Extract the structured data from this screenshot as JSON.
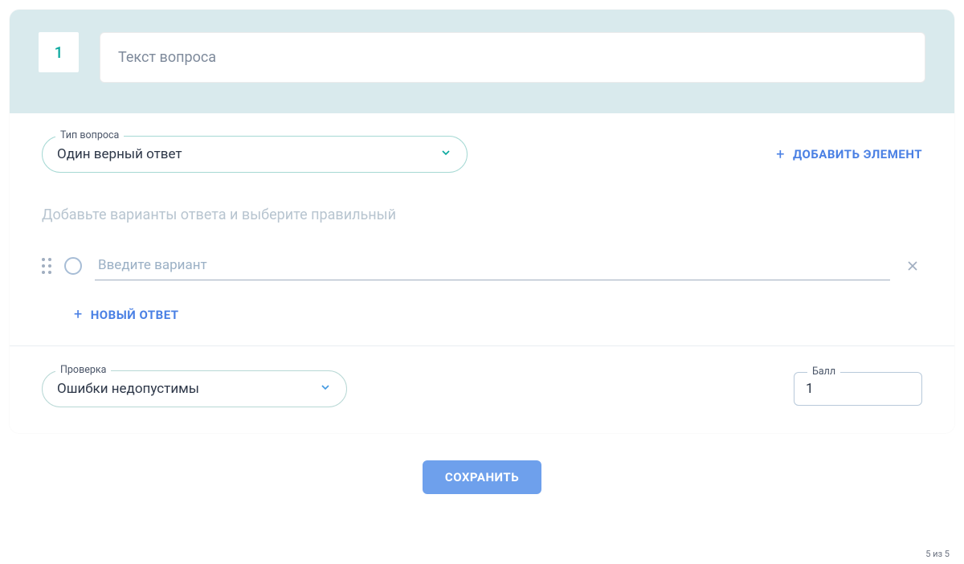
{
  "question": {
    "number": "1",
    "text_placeholder": "Текст вопроса"
  },
  "question_type": {
    "label": "Тип вопроса",
    "value": "Один верный ответ"
  },
  "add_element_label": "ДОБАВИТЬ ЭЛЕМЕНТ",
  "hint": "Добавьте варианты ответа и выберите правильный",
  "answer": {
    "placeholder": "Введите вариант"
  },
  "new_answer_label": "НОВЫЙ ОТВЕТ",
  "check": {
    "label": "Проверка",
    "value": "Ошибки недопустимы"
  },
  "score": {
    "label": "Балл",
    "value": "1"
  },
  "save_label": "СОХРАНИТЬ",
  "page_counter": "5 из 5"
}
